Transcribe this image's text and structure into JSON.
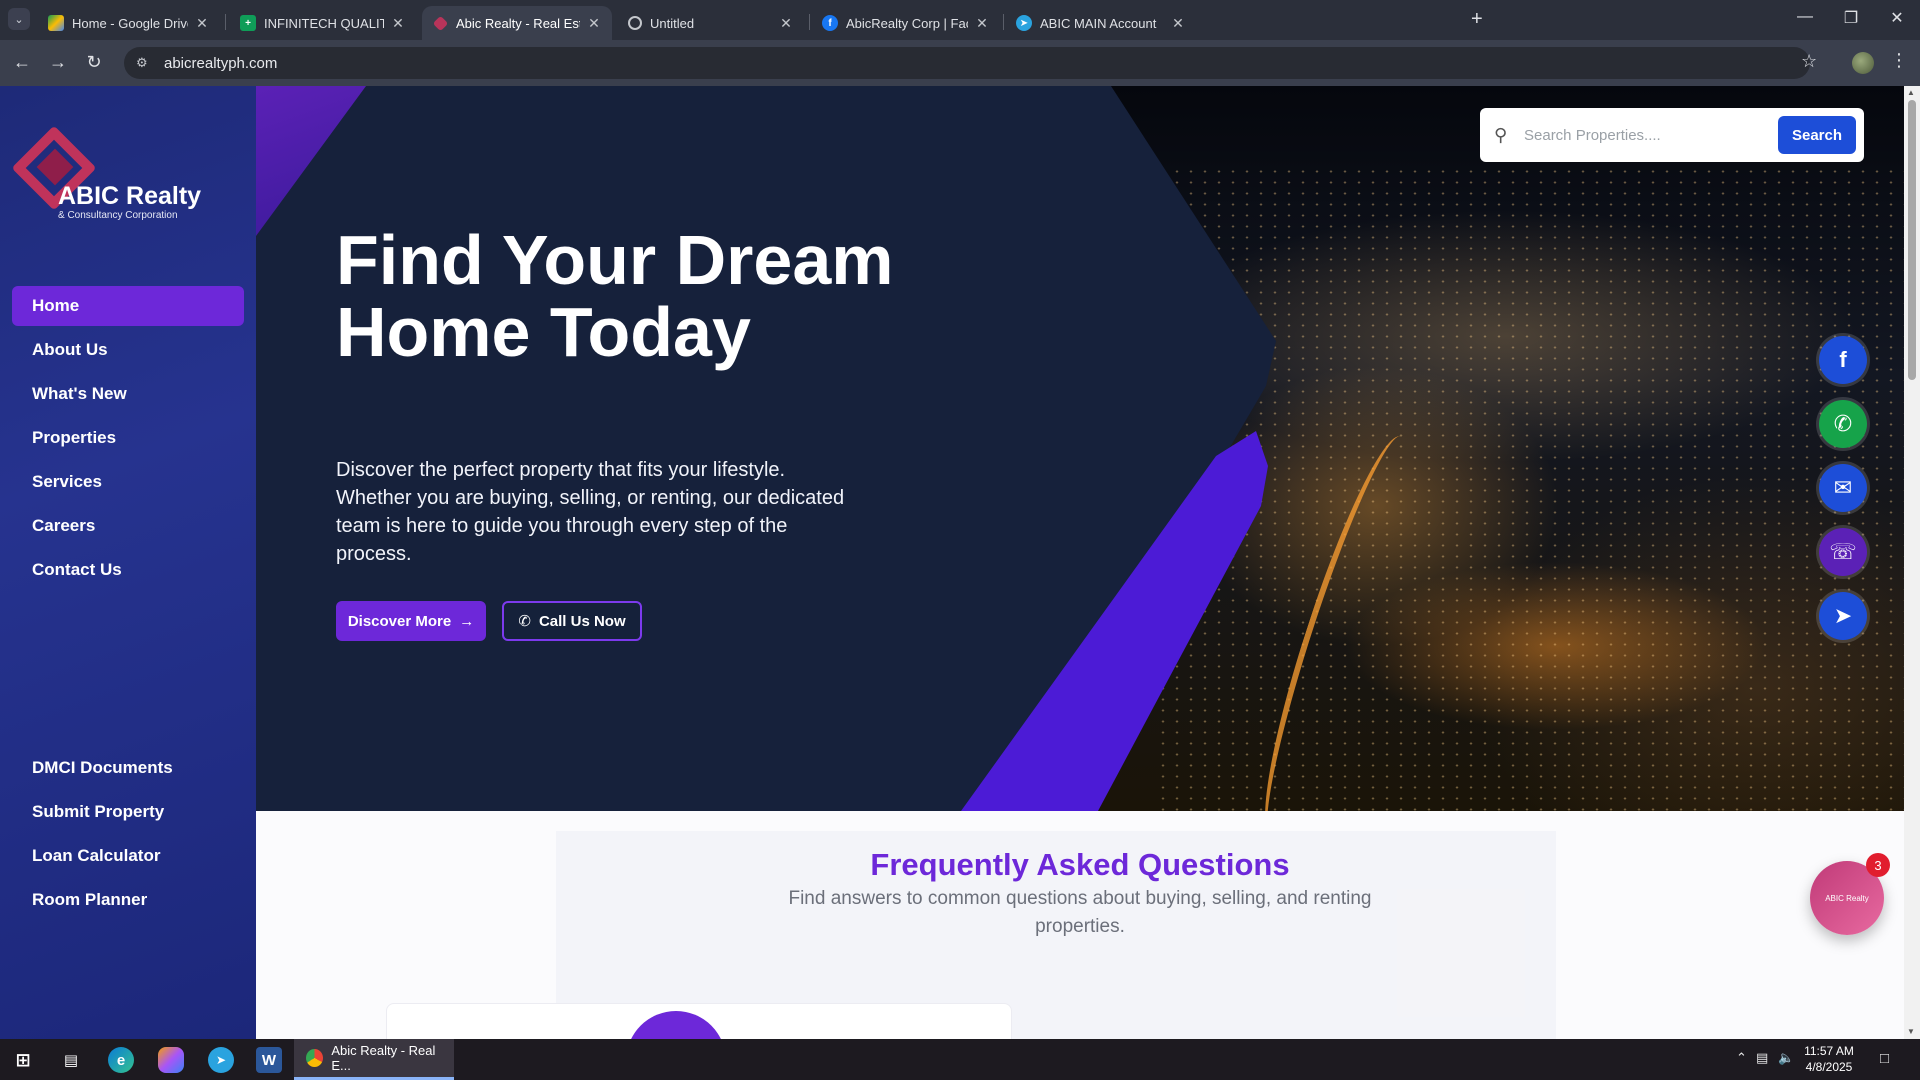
{
  "browser": {
    "tabs": [
      {
        "label": "Home - Google Drive",
        "icon": "google-drive-icon"
      },
      {
        "label": "INFINITECH QUALITY ASSURAN",
        "icon": "google-sheets-icon"
      },
      {
        "label": "Abic Realty - Real Estate Sales, I",
        "icon": "abic-realty-icon",
        "active": true
      },
      {
        "label": "Untitled",
        "icon": "globe-icon"
      },
      {
        "label": "AbicRealty Corp | Facebook",
        "icon": "facebook-icon"
      },
      {
        "label": "ABIC MAIN Account",
        "icon": "telegram-icon"
      }
    ],
    "url": "abicrealtyph.com"
  },
  "sidebar": {
    "logo_title": "ABIC Realty",
    "logo_subtitle": "& Consultancy Corporation",
    "nav_primary": [
      "Home",
      "About Us",
      "What's New",
      "Properties",
      "Services",
      "Careers",
      "Contact Us"
    ],
    "nav_secondary": [
      "DMCI Documents",
      "Submit Property",
      "Loan Calculator",
      "Room Planner"
    ],
    "active": "Home"
  },
  "hero": {
    "title": "Find Your Dream Home Today",
    "description": "Discover the perfect property that fits your lifestyle. Whether you are buying, selling, or renting, our dedicated team is here to guide you through every step of the process.",
    "discover_label": "Discover More",
    "call_label": "Call Us Now"
  },
  "search": {
    "placeholder": "Search Properties....",
    "button_label": "Search"
  },
  "social": [
    "facebook-icon",
    "whatsapp-icon",
    "email-icon",
    "viber-icon",
    "telegram-icon"
  ],
  "faq": {
    "title": "Frequently Asked Questions",
    "subtitle": "Find answers to common questions about buying, selling, and renting properties."
  },
  "chat": {
    "badge_count": "3",
    "logo_text": "ABIC Realty"
  },
  "taskbar": {
    "active_window": "Abic Realty - Real E...",
    "time": "11:57 AM",
    "date": "4/8/2025"
  },
  "colors": {
    "brand_purple": "#6d28d9",
    "sidebar_blue": "#1e2a78",
    "search_blue": "#1d4ed8",
    "hero_navy": "#16213b"
  }
}
